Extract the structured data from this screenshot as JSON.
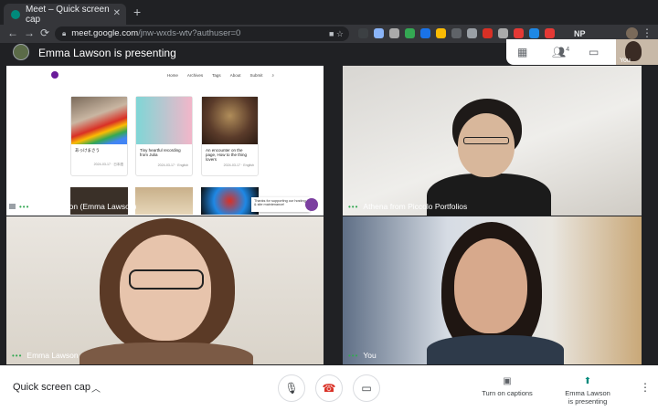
{
  "browser": {
    "tab_title": "Meet – Quick screen cap",
    "url_host": "meet.google.com",
    "url_path": "/jnw-wxds-wtv?authuser=0",
    "extension_text": "NP",
    "extension_colors": [
      "#3c4043",
      "#8ab4f8",
      "#aaaaaa",
      "#34a853",
      "#1a73e8",
      "#fbbc04",
      "#5f6368",
      "#9aa0a6",
      "#d93025",
      "#aaaaaa",
      "#e53935",
      "#1e88e5",
      "#e53935"
    ]
  },
  "header": {
    "presenter_text": "Emma Lawson is presenting",
    "people_count": "4",
    "self_label": "You"
  },
  "presentation": {
    "nav_items": [
      "Home",
      "Archives",
      "Tags",
      "About",
      "Submit"
    ],
    "cards": [
      {
        "title": "あっけまさう",
        "meta": "2024-03-17 · 日本語"
      },
      {
        "title": "Tiny heartful recording from Julia",
        "meta": "2024-03-17 · English"
      },
      {
        "title": "An encounter on the page, How to the thing lovers",
        "meta": "2024-03-17 · English"
      }
    ],
    "toast_text": "Thanks for supporting our hosting & site maintenance!",
    "label": "Presentation (Emma Lawson)"
  },
  "tiles": {
    "athena_label": "Athena from Piccolo Portfolios",
    "emma_label": "Emma Lawson",
    "you_label": "You"
  },
  "bottom": {
    "meeting_name": "Quick screen cap",
    "captions_label": "Turn on captions",
    "presenting_label_1": "Emma Lawson",
    "presenting_label_2": "is presenting"
  }
}
